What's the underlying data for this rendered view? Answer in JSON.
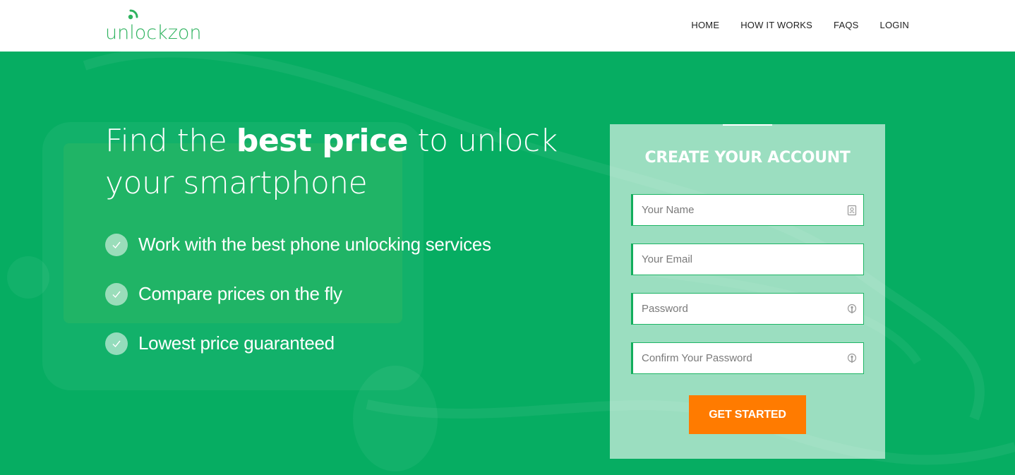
{
  "brand": {
    "name": "unlockzon",
    "color": "#2fb35f"
  },
  "nav": {
    "items": [
      "HOME",
      "HOW IT WORKS",
      "FAQS",
      "LOGIN"
    ]
  },
  "hero": {
    "headline_part1": "Find the ",
    "headline_bold": "best price",
    "headline_part2": " to unlock your smartphone",
    "features": [
      "Work with the best phone unlocking services",
      "Compare prices on the fly",
      "Lowest price guaranteed"
    ],
    "background_color": "#06ad62"
  },
  "form": {
    "title": "CREATE YOUR ACCOUNT",
    "fields": [
      {
        "placeholder": "Your Name",
        "value": "",
        "icon": "contact-card-icon"
      },
      {
        "placeholder": "Your Email",
        "value": "",
        "icon": ""
      },
      {
        "placeholder": "Password",
        "value": "",
        "icon": "key-icon"
      },
      {
        "placeholder": "Confirm Your Password",
        "value": "",
        "icon": "key-icon"
      }
    ],
    "submit_label": "GET STARTED",
    "submit_color": "#ff7b00"
  }
}
